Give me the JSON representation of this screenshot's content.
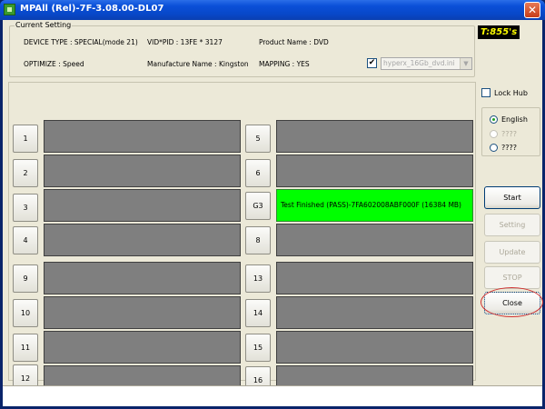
{
  "window": {
    "title": "MPAll (Rel)-7F-3.08.00-DL07",
    "close_glyph": "✕"
  },
  "setting": {
    "legend": "Current Setting",
    "device_type": "DEVICE TYPE : SPECIAL(mode 21)",
    "vid_pid": "VID*PID : 13FE * 3127",
    "product_name": "Product Name : DVD",
    "optimize": "OPTIMIZE : Speed",
    "manufacture_name": "Manufacture Name : Kingston",
    "mapping": "MAPPING : YES",
    "config_checked": true,
    "config_check_glyph": "✔",
    "config_file": "hyperx_16Gb_dvd.ini",
    "dropdown_glyph": "▼"
  },
  "timer": "T:855's",
  "ports": [
    {
      "label": "1",
      "status": ""
    },
    {
      "label": "2",
      "status": ""
    },
    {
      "label": "3",
      "status": ""
    },
    {
      "label": "4",
      "status": ""
    },
    {
      "label": "5",
      "status": ""
    },
    {
      "label": "6",
      "status": ""
    },
    {
      "label": "G3",
      "status": "Test Finished (PASS)-7FA602008ABF000F (16384 MB)"
    },
    {
      "label": "8",
      "status": ""
    },
    {
      "label": "9",
      "status": ""
    },
    {
      "label": "10",
      "status": ""
    },
    {
      "label": "11",
      "status": ""
    },
    {
      "label": "12",
      "status": ""
    },
    {
      "label": "13",
      "status": ""
    },
    {
      "label": "14",
      "status": ""
    },
    {
      "label": "15",
      "status": ""
    },
    {
      "label": "16",
      "status": ""
    }
  ],
  "colors": {
    "pass": "#00ff00",
    "idle": "#7f7f7f"
  },
  "options": {
    "lock_hub_label": "Lock Hub",
    "lock_hub_checked": false,
    "languages": [
      {
        "label": "English",
        "selected": true,
        "enabled": true
      },
      {
        "label": "????",
        "selected": false,
        "enabled": false
      },
      {
        "label": "????",
        "selected": false,
        "enabled": true
      }
    ]
  },
  "actions": {
    "start": "Start",
    "setting": "Setting",
    "update": "Update",
    "stop": "STOP",
    "close": "Close"
  }
}
